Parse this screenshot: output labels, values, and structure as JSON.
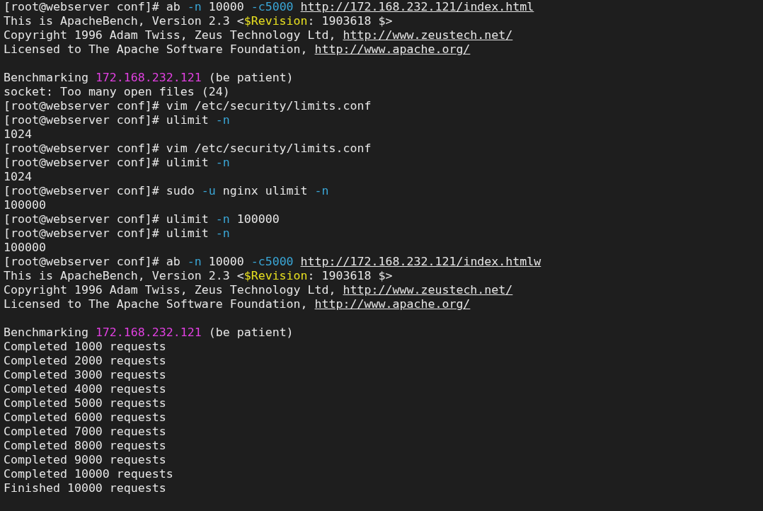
{
  "terminal": {
    "lines": [
      {
        "kind": "text",
        "segments": [
          {
            "kind": "plain",
            "text": "[root@webserver conf]# ab "
          },
          {
            "kind": "flag",
            "text": "-n"
          },
          {
            "kind": "plain",
            "text": " 10000 "
          },
          {
            "kind": "flag",
            "text": "-c5000 "
          },
          {
            "kind": "link",
            "text": "http://172.168.232.121/index.html"
          }
        ]
      },
      {
        "kind": "text",
        "segments": [
          {
            "kind": "plain",
            "text": "This is ApacheBench, Version 2.3 <"
          },
          {
            "kind": "keyword",
            "text": "$Revision"
          },
          {
            "kind": "plain",
            "text": ": 1903618 $>"
          }
        ]
      },
      {
        "kind": "text",
        "segments": [
          {
            "kind": "plain",
            "text": "Copyright 1996 Adam Twiss, Zeus Technology Ltd, "
          },
          {
            "kind": "link",
            "text": "http://www.zeustech.net/"
          }
        ]
      },
      {
        "kind": "text",
        "segments": [
          {
            "kind": "plain",
            "text": "Licensed to The Apache Software Foundation, "
          },
          {
            "kind": "link",
            "text": "http://www.apache.org/"
          }
        ]
      },
      {
        "kind": "blank"
      },
      {
        "kind": "text",
        "segments": [
          {
            "kind": "plain",
            "text": "Benchmarking "
          },
          {
            "kind": "host",
            "text": "172.168.232.121"
          },
          {
            "kind": "plain",
            "text": " (be patient)"
          }
        ]
      },
      {
        "kind": "text",
        "segments": [
          {
            "kind": "plain",
            "text": "socket: Too many open files (24)"
          }
        ]
      },
      {
        "kind": "text",
        "segments": [
          {
            "kind": "plain",
            "text": "[root@webserver conf]# vim /etc/security/limits.conf"
          }
        ]
      },
      {
        "kind": "text",
        "segments": [
          {
            "kind": "plain",
            "text": "[root@webserver conf]# ulimit "
          },
          {
            "kind": "flag",
            "text": "-n"
          }
        ]
      },
      {
        "kind": "text",
        "segments": [
          {
            "kind": "plain",
            "text": "1024"
          }
        ]
      },
      {
        "kind": "text",
        "segments": [
          {
            "kind": "plain",
            "text": "[root@webserver conf]# vim /etc/security/limits.conf"
          }
        ]
      },
      {
        "kind": "text",
        "segments": [
          {
            "kind": "plain",
            "text": "[root@webserver conf]# ulimit "
          },
          {
            "kind": "flag",
            "text": "-n"
          }
        ]
      },
      {
        "kind": "text",
        "segments": [
          {
            "kind": "plain",
            "text": "1024"
          }
        ]
      },
      {
        "kind": "text",
        "segments": [
          {
            "kind": "plain",
            "text": "[root@webserver conf]# sudo "
          },
          {
            "kind": "flag",
            "text": "-u"
          },
          {
            "kind": "plain",
            "text": " nginx ulimit "
          },
          {
            "kind": "flag",
            "text": "-n"
          }
        ]
      },
      {
        "kind": "text",
        "segments": [
          {
            "kind": "plain",
            "text": "100000"
          }
        ]
      },
      {
        "kind": "text",
        "segments": [
          {
            "kind": "plain",
            "text": "[root@webserver conf]# ulimit "
          },
          {
            "kind": "flag",
            "text": "-n"
          },
          {
            "kind": "plain",
            "text": " 100000"
          }
        ]
      },
      {
        "kind": "text",
        "segments": [
          {
            "kind": "plain",
            "text": "[root@webserver conf]# ulimit "
          },
          {
            "kind": "flag",
            "text": "-n"
          }
        ]
      },
      {
        "kind": "text",
        "segments": [
          {
            "kind": "plain",
            "text": "100000"
          }
        ]
      },
      {
        "kind": "text",
        "segments": [
          {
            "kind": "plain",
            "text": "[root@webserver conf]# ab "
          },
          {
            "kind": "flag",
            "text": "-n"
          },
          {
            "kind": "plain",
            "text": " 10000 "
          },
          {
            "kind": "flag",
            "text": "-c5000 "
          },
          {
            "kind": "link",
            "text": "http://172.168.232.121/index.htmlw"
          }
        ]
      },
      {
        "kind": "text",
        "segments": [
          {
            "kind": "plain",
            "text": "This is ApacheBench, Version 2.3 <"
          },
          {
            "kind": "keyword",
            "text": "$Revision"
          },
          {
            "kind": "plain",
            "text": ": 1903618 $>"
          }
        ]
      },
      {
        "kind": "text",
        "segments": [
          {
            "kind": "plain",
            "text": "Copyright 1996 Adam Twiss, Zeus Technology Ltd, "
          },
          {
            "kind": "link",
            "text": "http://www.zeustech.net/"
          }
        ]
      },
      {
        "kind": "text",
        "segments": [
          {
            "kind": "plain",
            "text": "Licensed to The Apache Software Foundation, "
          },
          {
            "kind": "link",
            "text": "http://www.apache.org/"
          }
        ]
      },
      {
        "kind": "blank"
      },
      {
        "kind": "text",
        "segments": [
          {
            "kind": "plain",
            "text": "Benchmarking "
          },
          {
            "kind": "host",
            "text": "172.168.232.121"
          },
          {
            "kind": "plain",
            "text": " (be patient)"
          }
        ]
      },
      {
        "kind": "text",
        "segments": [
          {
            "kind": "plain",
            "text": "Completed 1000 requests"
          }
        ]
      },
      {
        "kind": "text",
        "segments": [
          {
            "kind": "plain",
            "text": "Completed 2000 requests"
          }
        ]
      },
      {
        "kind": "text",
        "segments": [
          {
            "kind": "plain",
            "text": "Completed 3000 requests"
          }
        ]
      },
      {
        "kind": "text",
        "segments": [
          {
            "kind": "plain",
            "text": "Completed 4000 requests"
          }
        ]
      },
      {
        "kind": "text",
        "segments": [
          {
            "kind": "plain",
            "text": "Completed 5000 requests"
          }
        ]
      },
      {
        "kind": "text",
        "segments": [
          {
            "kind": "plain",
            "text": "Completed 6000 requests"
          }
        ]
      },
      {
        "kind": "text",
        "segments": [
          {
            "kind": "plain",
            "text": "Completed 7000 requests"
          }
        ]
      },
      {
        "kind": "text",
        "segments": [
          {
            "kind": "plain",
            "text": "Completed 8000 requests"
          }
        ]
      },
      {
        "kind": "text",
        "segments": [
          {
            "kind": "plain",
            "text": "Completed 9000 requests"
          }
        ]
      },
      {
        "kind": "text",
        "segments": [
          {
            "kind": "plain",
            "text": "Completed 10000 requests"
          }
        ]
      },
      {
        "kind": "text",
        "segments": [
          {
            "kind": "plain",
            "text": "Finished 10000 requests"
          }
        ]
      }
    ]
  }
}
